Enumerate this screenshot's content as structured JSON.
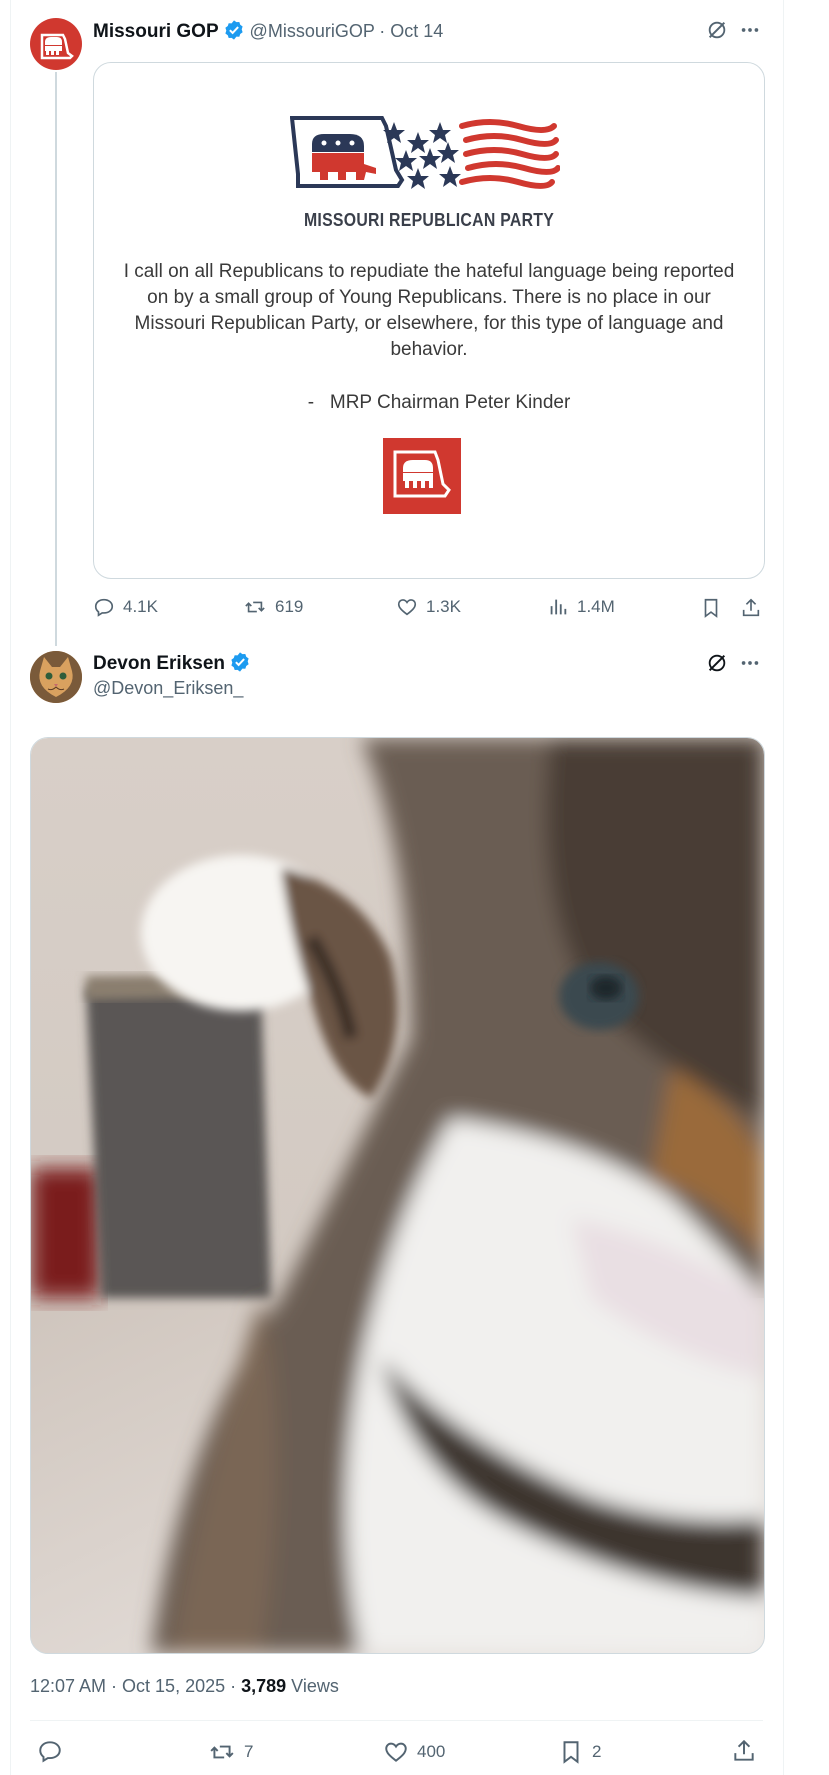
{
  "tweet1": {
    "display_name": "Missouri GOP",
    "handle": "@MissouriGOP",
    "date": "· Oct 14",
    "statement": {
      "logo_text": "MISSOURI REPUBLICAN PARTY",
      "lines": [
        "I call on all Republicans to repudiate the hateful language being reported",
        "on by a small group of Young Republicans. There is no place in our",
        "Missouri Republican Party, or elsewhere, for this type of language and",
        "behavior."
      ],
      "signature": "-   MRP Chairman Peter Kinder"
    },
    "stats": {
      "replies": "4.1K",
      "reposts": "619",
      "likes": "1.3K",
      "views": "1.4M"
    }
  },
  "tweet2": {
    "display_name": "Devon Eriksen",
    "handle": "@Devon_Eriksen_",
    "timestamp": "12:07 AM · Oct 15, 2025 · ",
    "views_count": "3,789",
    "views_label": " Views",
    "stats": {
      "reposts": "7",
      "likes": "400",
      "bookmarks": "2"
    }
  },
  "colors": {
    "accent": "#1d9bf0",
    "gop_red": "#d0382f",
    "navy": "#2b3857",
    "muted": "#536471"
  }
}
